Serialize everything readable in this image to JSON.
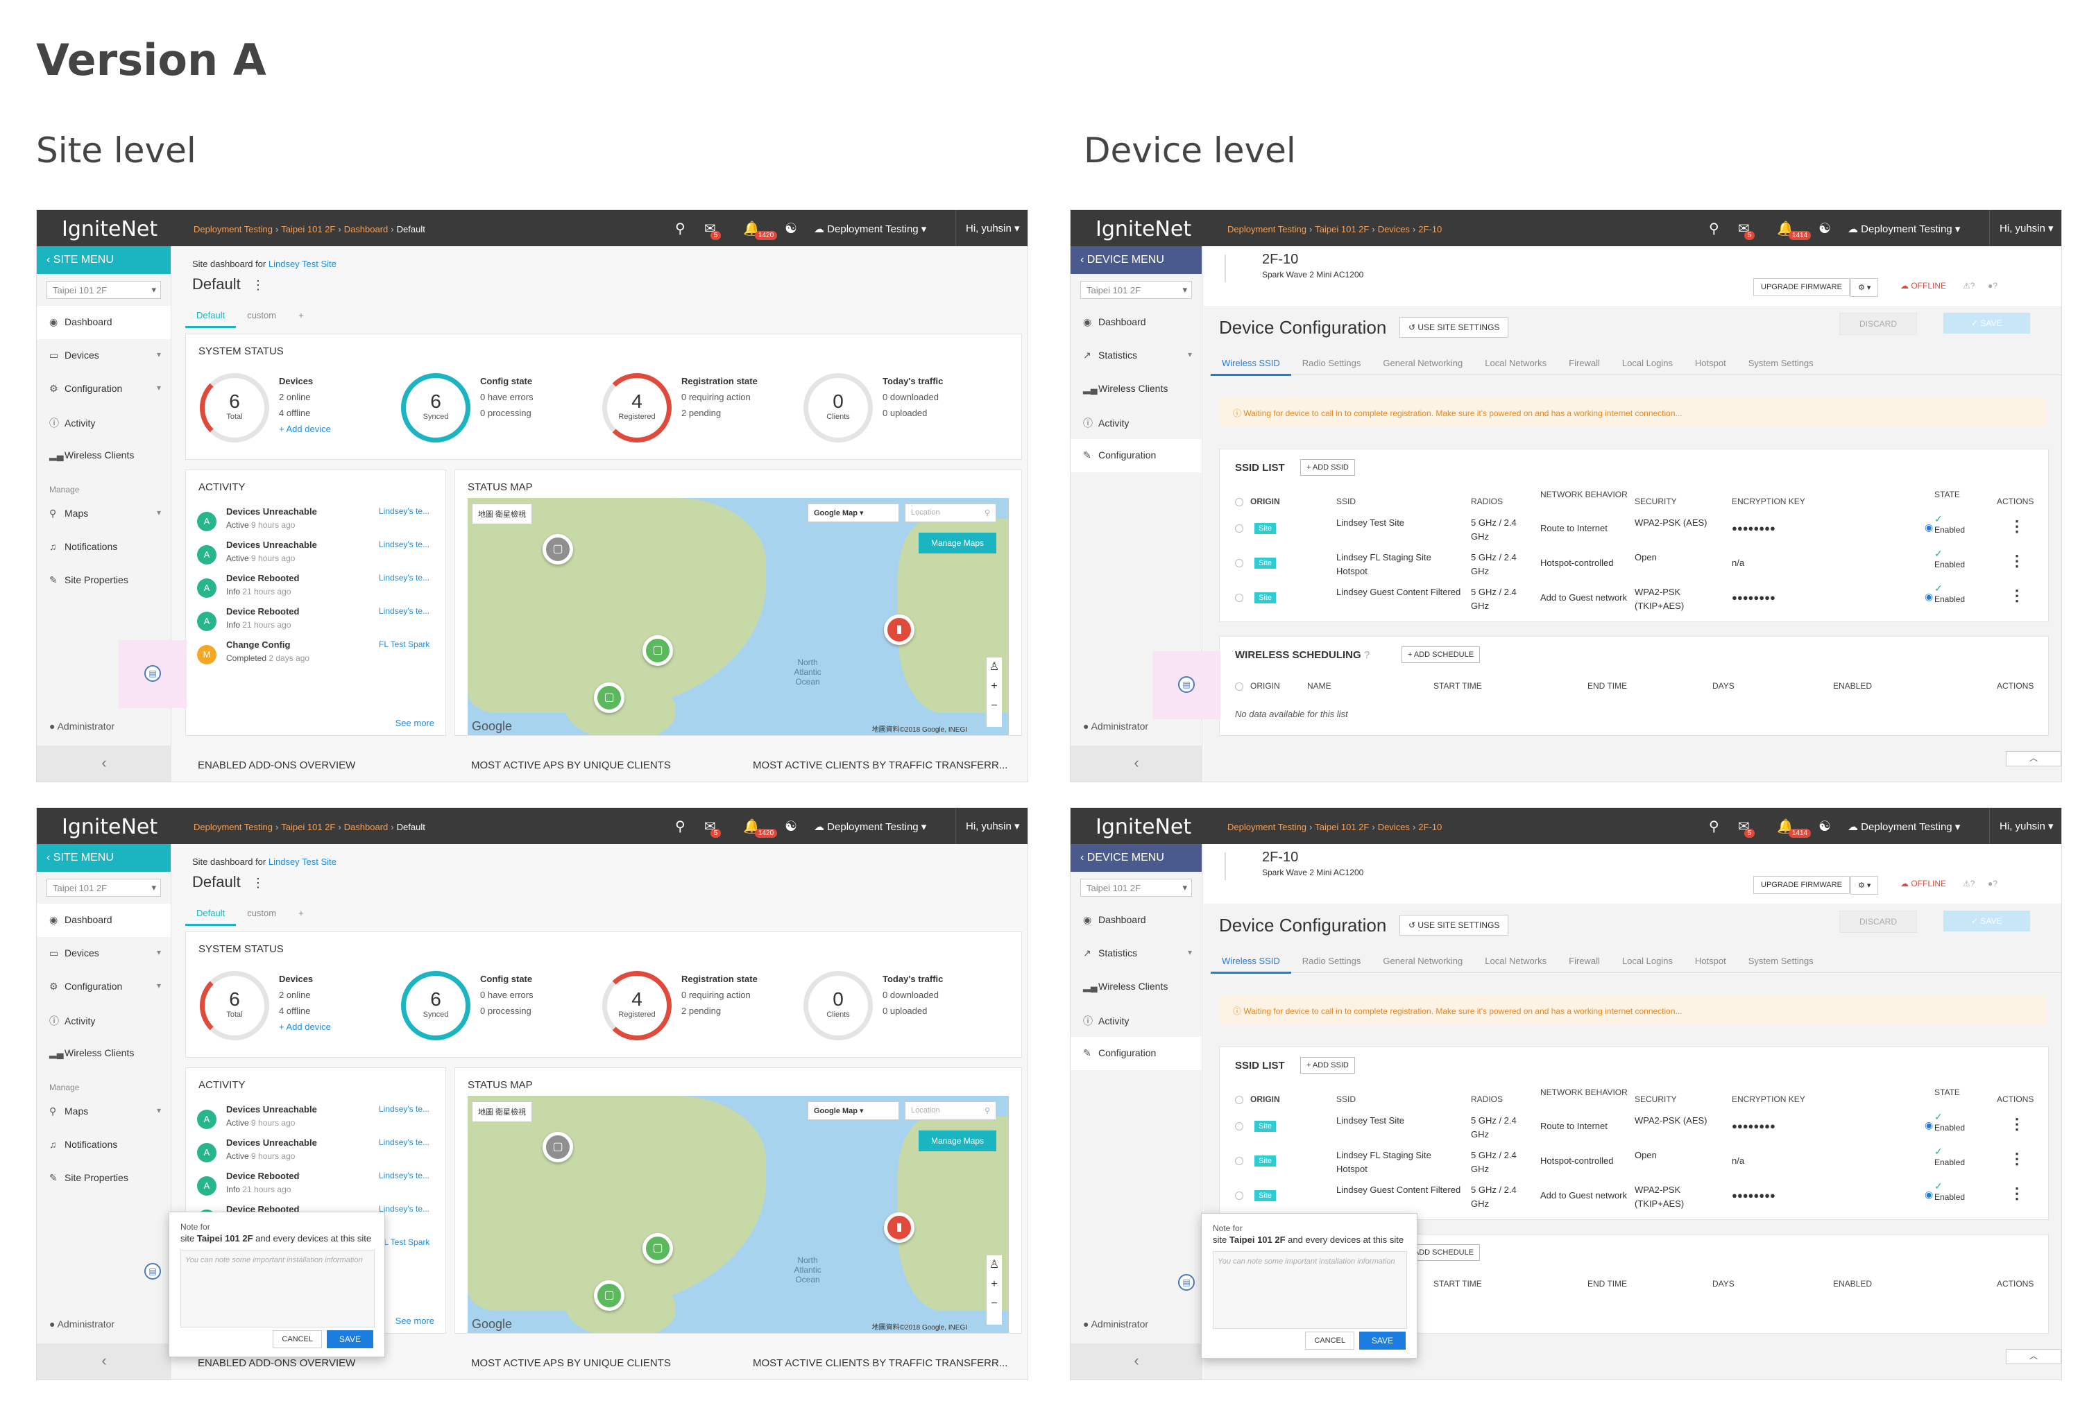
{
  "headings": {
    "version": "Version A",
    "site": "Site level",
    "device": "Device level"
  },
  "common": {
    "logo": "IgniteNet",
    "org": "Deployment Testing",
    "user": "Hi, yuhsin",
    "site_select": "Taipei 101 2F",
    "admin": "Administrator",
    "crumb_org": "Deployment Testing",
    "crumb_site": "Taipei 101 2F"
  },
  "site": {
    "badges": {
      "messages": "5",
      "alerts": "1420"
    },
    "crumbs": {
      "c3": "Dashboard",
      "c4": "Default"
    },
    "menu_head": "SITE MENU",
    "menu": [
      "Dashboard",
      "Devices",
      "Configuration",
      "Activity",
      "Wireless Clients"
    ],
    "manage_label": "Manage",
    "manage": [
      "Maps",
      "Notifications",
      "Site Properties"
    ],
    "site_for": "Site dashboard for",
    "site_link": "Lindsey Test Site",
    "title": "Default",
    "tabs": [
      "Default",
      "custom",
      "+"
    ],
    "system_status": "SYSTEM STATUS",
    "devices": {
      "n": "6",
      "s": "Total",
      "title": "Devices",
      "l1": "2 online",
      "l2": "4 offline",
      "link": "+ Add device"
    },
    "config": {
      "n": "6",
      "s": "Synced",
      "title": "Config state",
      "l1": "0 have errors",
      "l2": "0 processing"
    },
    "registration": {
      "n": "4",
      "s": "Registered",
      "title": "Registration state",
      "l1": "0 requiring action",
      "l2": "2 pending"
    },
    "traffic": {
      "n": "0",
      "s": "Clients",
      "title": "Today's traffic",
      "l1": "0 downloaded",
      "l2": "0 uploaded"
    },
    "activity_title": "ACTIVITY",
    "activity": [
      {
        "av": "A",
        "t": "Devices Unreachable",
        "st": "Active",
        "time": "9 hours ago",
        "r": "Lindsey's te..."
      },
      {
        "av": "A",
        "t": "Devices Unreachable",
        "st": "Active",
        "time": "9 hours ago",
        "r": "Lindsey's te..."
      },
      {
        "av": "A",
        "t": "Device Rebooted",
        "st": "Info",
        "time": "21 hours ago",
        "r": "Lindsey's te..."
      },
      {
        "av": "A",
        "t": "Device Rebooted",
        "st": "Info",
        "time": "21 hours ago",
        "r": "Lindsey's te..."
      },
      {
        "av": "M",
        "t": "Change Config",
        "st": "Completed",
        "time": "2 days ago",
        "r": "FL Test Spark"
      }
    ],
    "see_more": "See more",
    "status_map": "STATUS MAP",
    "map_type": "Google Map",
    "map_location": "Location",
    "manage_maps": "Manage Maps",
    "map_tabs": "地圖   衛星檢視",
    "map_copyright": "地圖資料©2018 Google, INEGI",
    "map_labels": [
      "North Atlantic Ocean"
    ],
    "bottom_titles": [
      "ENABLED ADD-ONS OVERVIEW",
      "MOST ACTIVE APS BY UNIQUE CLIENTS",
      "MOST ACTIVE CLIENTS BY TRAFFIC TRANSFERR..."
    ]
  },
  "device": {
    "badges": {
      "messages": "5",
      "alerts": "1414"
    },
    "crumbs": {
      "c3": "Devices",
      "c4": "2F-10"
    },
    "menu_head": "DEVICE MENU",
    "menu": [
      "Dashboard",
      "Statistics",
      "Wireless Clients",
      "Activity",
      "Configuration"
    ],
    "name": "2F-10",
    "model": "Spark Wave 2 Mini AC1200",
    "upgrade": "UPGRADE FIRMWARE",
    "offline": "OFFLINE",
    "title": "Device Configuration",
    "use_site": "USE SITE SETTINGS",
    "discard": "DISCARD",
    "save": "SAVE",
    "tabs": [
      "Wireless SSID",
      "Radio Settings",
      "General Networking",
      "Local Networks",
      "Firewall",
      "Local Logins",
      "Hotspot",
      "System Settings"
    ],
    "warning": "Waiting for device to call in to complete registration. Make sure it's powered on and has a working internet connection...",
    "ssid_list": "SSID LIST",
    "add_ssid": "ADD SSID",
    "ssid_cols": [
      "ORIGIN",
      "SSID",
      "RADIOS",
      "NETWORK BEHAVIOR",
      "SECURITY",
      "ENCRYPTION KEY",
      "STATE",
      "ACTIONS"
    ],
    "ssids": [
      {
        "origin": "Site",
        "ssid": "Lindsey Test Site",
        "radios": "5 GHz / 2.4 GHz",
        "behavior": "Route to Internet",
        "security": "WPA2-PSK (AES)",
        "key": "●●●●●●●●",
        "state": "Enabled"
      },
      {
        "origin": "Site",
        "ssid": "Lindsey FL Staging Site Hotspot",
        "radios": "5 GHz / 2.4 GHz",
        "behavior": "Hotspot-controlled",
        "security": "Open",
        "key": "n/a",
        "state": "Enabled"
      },
      {
        "origin": "Site",
        "ssid": "Lindsey Guest Content Filtered",
        "radios": "5 GHz / 2.4 GHz",
        "behavior": "Add to Guest network",
        "security": "WPA2-PSK (TKIP+AES)",
        "key": "●●●●●●●●",
        "state": "Enabled"
      }
    ],
    "wireless_scheduling": "WIRELESS SCHEDULING",
    "add_schedule": "ADD SCHEDULE",
    "sched_cols": [
      "ORIGIN",
      "NAME",
      "START TIME",
      "END TIME",
      "DAYS",
      "ENABLED",
      "ACTIONS"
    ],
    "no_data": "No data available for this list"
  },
  "popup": {
    "note_for": "Note for",
    "site_prefix": "site",
    "site_name": "Taipei 101 2F",
    "suffix": "and every devices at this site",
    "placeholder": "You can note some important installation information",
    "cancel": "CANCEL",
    "save": "SAVE"
  }
}
